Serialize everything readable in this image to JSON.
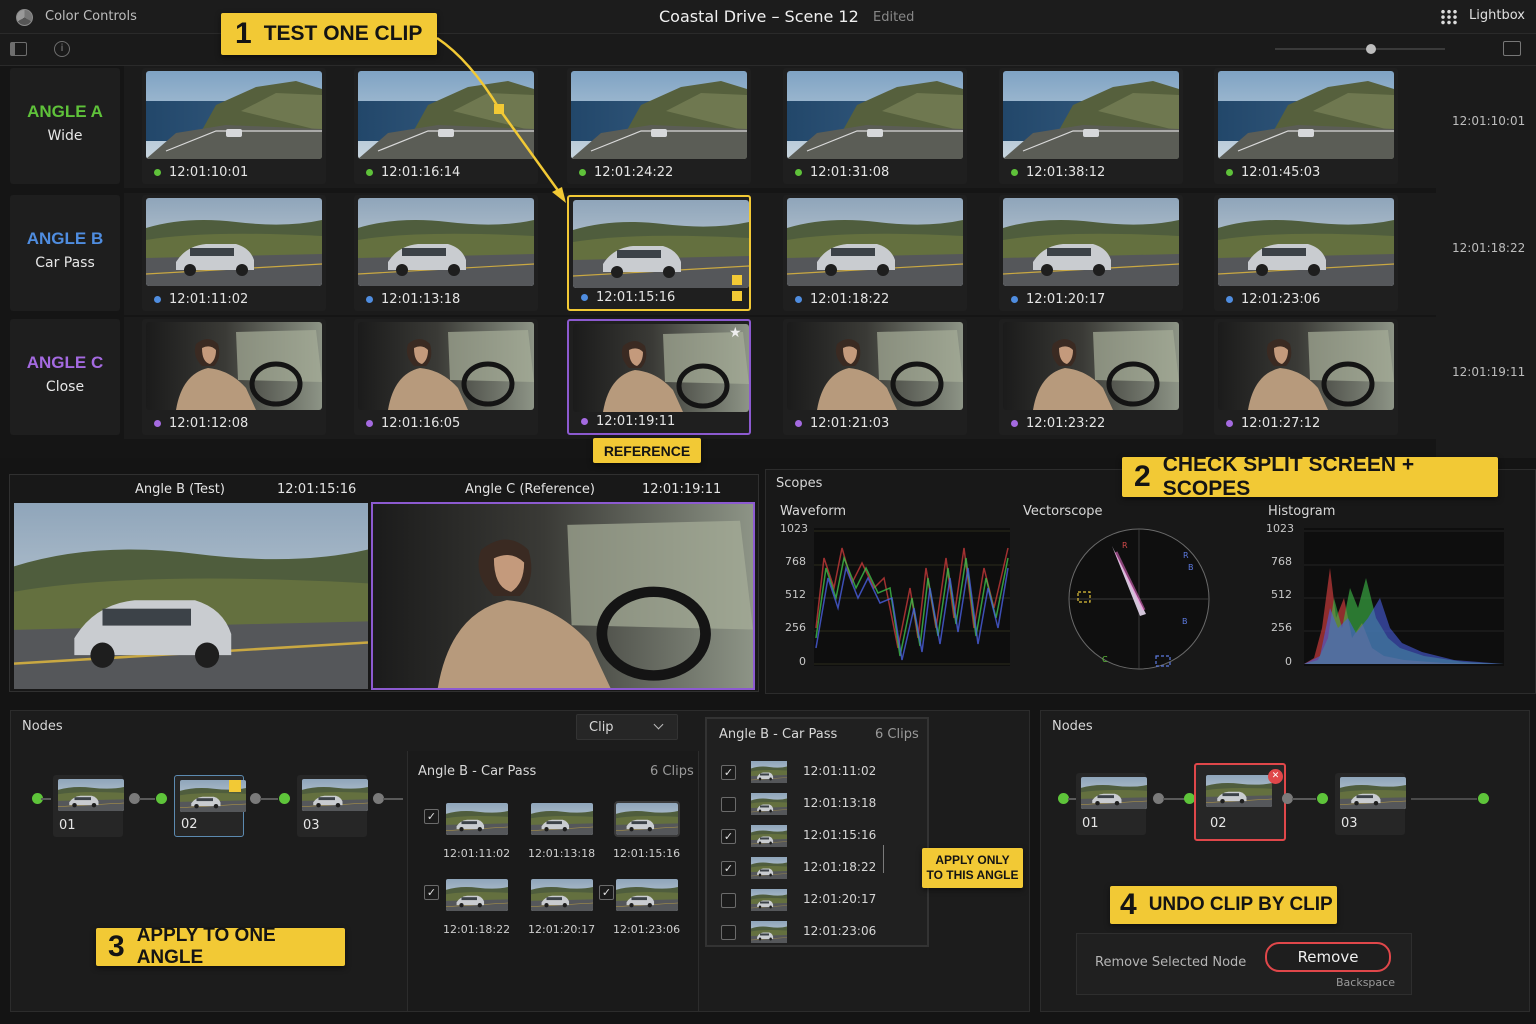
{
  "app": {
    "title": "Color Controls",
    "project": "Coastal Drive – Scene 12",
    "status": "Edited",
    "lightbox": "Lightbox"
  },
  "colors": {
    "accent": "#f2c935",
    "angle_a": "#5fc23a",
    "angle_b": "#4f8de0",
    "angle_c": "#a46ae0",
    "reference": "#8c5ad0",
    "remove": "#e0474a"
  },
  "angles": [
    {
      "name": "ANGLE A",
      "desc": "Wide",
      "side_tc": "12:01:10:01",
      "clips": [
        "12:01:10:01",
        "12:01:16:14",
        "12:01:24:22",
        "12:01:31:08",
        "12:01:38:12",
        "12:01:45:03"
      ]
    },
    {
      "name": "ANGLE B",
      "desc": "Car Pass",
      "side_tc": "12:01:18:22",
      "clips": [
        "12:01:11:02",
        "12:01:13:18",
        "12:01:15:16",
        "12:01:18:22",
        "12:01:20:17",
        "12:01:23:06"
      ]
    },
    {
      "name": "ANGLE C",
      "desc": "Close",
      "side_tc": "12:01:19:11",
      "clips": [
        "12:01:12:08",
        "12:01:16:05",
        "12:01:19:11",
        "12:01:21:03",
        "12:01:23:22",
        "12:01:27:12"
      ]
    }
  ],
  "reference_label": "REFERENCE",
  "callouts": {
    "c1": {
      "num": "1",
      "text": "TEST ONE CLIP"
    },
    "c2": {
      "num": "2",
      "text": "CHECK SPLIT SCREEN + SCOPES"
    },
    "c3": {
      "num": "3",
      "text": "APPLY TO ONE ANGLE"
    },
    "c4": {
      "num": "4",
      "text": "UNDO CLIP BY CLIP"
    },
    "apply_only_1": "APPLY ONLY",
    "apply_only_2": "TO THIS ANGLE"
  },
  "viewer": {
    "left_label": "Angle B (Test)",
    "left_tc": "12:01:15:16",
    "right_label": "Angle C (Reference)",
    "right_tc": "12:01:19:11"
  },
  "scopes": {
    "title": "Scopes",
    "waveform": {
      "title": "Waveform",
      "ticks": [
        "1023",
        "768",
        "512",
        "256",
        "0"
      ]
    },
    "vectorscope": {
      "title": "Vectorscope",
      "marks": [
        "R",
        "R",
        "B",
        "B",
        "C"
      ]
    },
    "histogram": {
      "title": "Histogram",
      "ticks": [
        "1023",
        "768",
        "512",
        "256",
        "0"
      ]
    }
  },
  "nodes_left": {
    "title": "Nodes",
    "nodes": [
      "01",
      "02",
      "03"
    ]
  },
  "clip_dropdown": {
    "value": "Clip"
  },
  "angle_group": {
    "title": "Angle B - Car Pass",
    "count": "6 Clips",
    "clips": [
      "12:01:11:02",
      "12:01:13:18",
      "12:01:15:16",
      "12:01:18:22",
      "12:01:20:17",
      "12:01:23:06"
    ]
  },
  "angle_list": {
    "title": "Angle B - Car Pass",
    "count": "6 Clips",
    "items": [
      {
        "tc": "12:01:11:02",
        "checked": true
      },
      {
        "tc": "12:01:13:18",
        "checked": false
      },
      {
        "tc": "12:01:15:16",
        "checked": true
      },
      {
        "tc": "12:01:18:22",
        "checked": true
      },
      {
        "tc": "12:01:20:17",
        "checked": false
      },
      {
        "tc": "12:01:23:06",
        "checked": false
      }
    ]
  },
  "nodes_right": {
    "title": "Nodes",
    "nodes": [
      "01",
      "02",
      "03"
    ]
  },
  "remove": {
    "label": "Remove Selected Node",
    "button": "Remove",
    "shortcut": "Backspace"
  },
  "checks": {
    "mark": "✓",
    "star": "★",
    "close": "✕"
  }
}
